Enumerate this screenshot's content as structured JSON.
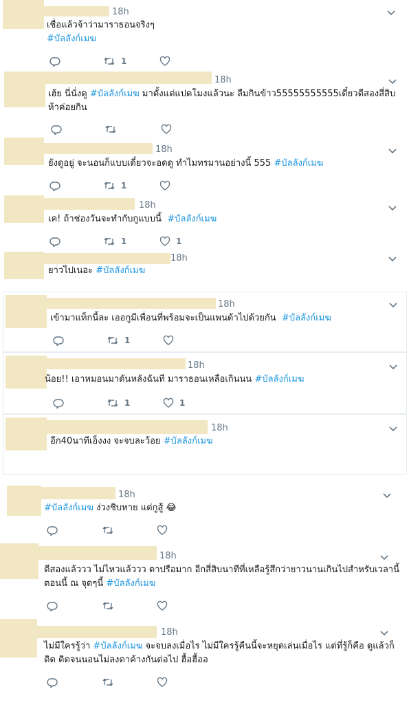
{
  "tweets": [
    {
      "time": "18h",
      "prefix": "เชื่อแล้วจ้าว่ามาราธอนจริงๆ\n",
      "hashtag": "#บัลลังก์เมฆ",
      "suffix": "",
      "reply": "",
      "retweet": "1",
      "like": ""
    },
    {
      "time": "18h",
      "prefix": "เฮ้ย นี่นั่งดู ",
      "hashtag": "#บัลลังก์เมฆ",
      "suffix": " มาตั้งแต่แปดโมงแล้วนะ ลืมกินข้าว55555555555เดี๋ยวตีสองสี่สิบห้าค่อยกิน",
      "reply": "",
      "retweet": "",
      "like": ""
    },
    {
      "time": "18h",
      "prefix": "ยังดูอยู่ จะนอนก็แบบเดี๋ยวจะอดดู ทำไมทรมานอย่างนี้ 555 ",
      "hashtag": "#บัลลังก์เมฆ",
      "suffix": "",
      "reply": "",
      "retweet": "1",
      "like": ""
    },
    {
      "time": "18h",
      "prefix": "เค! ถ้าช่องวันจะทำกับกูแบบนี้  ",
      "hashtag": "#บัลลังก์เมฆ",
      "suffix": "",
      "reply": "",
      "retweet": "1",
      "like": "1"
    },
    {
      "time": "18h",
      "prefix": "ยาวไปเนอะ ",
      "hashtag": "#บัลลังก์เมฆ",
      "suffix": "",
      "reply": "",
      "retweet": "",
      "like": ""
    },
    {
      "time": "18h",
      "prefix": "เข้ามาแท็กนี้ละ เออกูมีเพื่อนที่พร้อมจะเป็นแพนด้าไปด้วยกัน  ",
      "hashtag": "#บัลลังก์เมฆ",
      "suffix": "",
      "reply": "",
      "retweet": "1",
      "like": ""
    },
    {
      "time": "18h",
      "prefix": "น้อย!! เอาหมอนมาดันหลังฉันที มาราธอนเหลือเกินนน ",
      "hashtag": "#บัลลังก์เมฆ",
      "suffix": "",
      "reply": "",
      "retweet": "1",
      "like": "1"
    },
    {
      "time": "18h",
      "prefix": "อีก40นาทีเอ็งงง จะจบละว้อย ",
      "hashtag": "#บัลลังก์เมฆ",
      "suffix": "",
      "reply": "",
      "retweet": "",
      "like": ""
    },
    {
      "time": "18h",
      "prefix": "",
      "hashtag": "#บัลลังก์เมฆ",
      "suffix": " ง่วงชิบหาย แต่กูสู้ 😂",
      "reply": "",
      "retweet": "",
      "like": ""
    },
    {
      "time": "18h",
      "prefix": "ตีสองแล้ววว ไม่ไหวแล้ววว ตาปรือมาก อีกสี่สิบนาทีที่เหลือรู้สึกว่ายาวนานเกินไปสำหรับเวลานี้ ตอนนี้ ณ จุดๆนี้ ",
      "hashtag": "#บัลลังก์เมฆ",
      "suffix": "",
      "reply": "",
      "retweet": "",
      "like": ""
    },
    {
      "time": "18h",
      "prefix": "ไม่มีใครรู้ว่า ",
      "hashtag": "#บัลลังก์เมฆ",
      "suffix": " จะจบลงเมื่อไร ไม่มีใครรู้คืนนี้จะหยุดเล่นเมื่อไร แต่ที่รู้ก็คือ ดูแล้วก็ติด ติดจนนอนไม่ลงตาค้างกันต่อไป ฮื้อฮื้ออ",
      "reply": "",
      "retweet": "",
      "like": ""
    }
  ],
  "colors": {
    "hashtag": "#1b95e0",
    "icon": "#657786",
    "border": "#e6ecf0",
    "redaction": "#f2e7c3"
  },
  "icons": {
    "reply": "reply-icon",
    "retweet": "retweet-icon",
    "like": "heart-icon",
    "menu": "chevron-down-icon"
  }
}
